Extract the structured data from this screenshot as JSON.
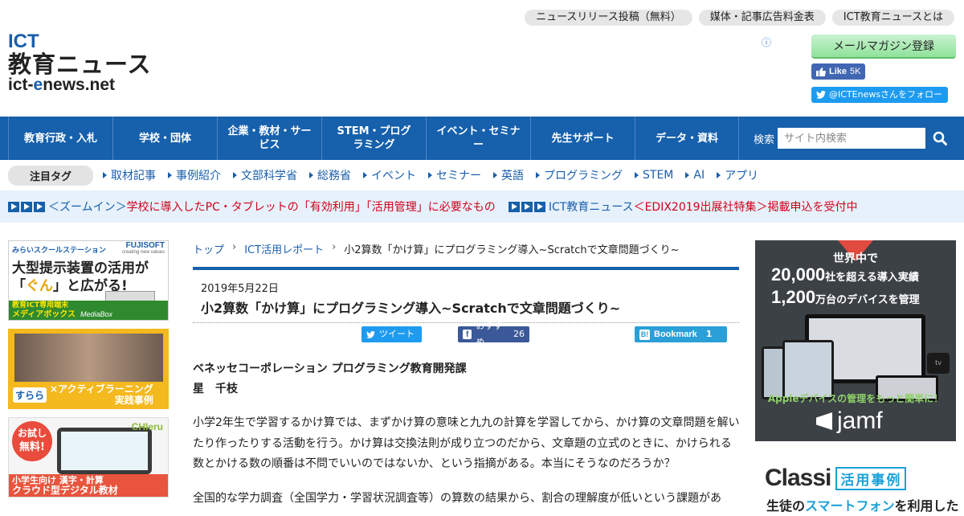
{
  "logo": {
    "line1": "ICT",
    "line2": "教育ニュース",
    "line3a": "ict-",
    "line3b": "e",
    "line3c": "news.net"
  },
  "toplinks": [
    "ニュースリリース投稿（無料）",
    "媒体・記事広告料金表",
    "ICT教育ニュースとは"
  ],
  "mail_button": "メールマガジン登録",
  "fb_like": {
    "label": "Like",
    "count": "5K"
  },
  "twitter_follow": "@ICTEnewsさんをフォロー",
  "nav": {
    "items": [
      "教育行政・入札",
      "学校・団体",
      "企業・教材・サービス",
      "STEM・プログラミング",
      "イベント・セミナー",
      "先生サポート",
      "データ・資料"
    ],
    "search_label": "検索",
    "search_placeholder": "サイト内検索"
  },
  "tags": {
    "title": "注目タグ",
    "items": [
      "取材記事",
      "事例紹介",
      "文部科学省",
      "総務省",
      "イベント",
      "セミナー",
      "英語",
      "プログラミング",
      "STEM",
      "AI",
      "アプリ"
    ]
  },
  "ticker": [
    {
      "blue": "＜ズームイン＞",
      "red": "学校に導入したPC・タブレットの「有効利用」「活用管理」に必要なもの"
    },
    {
      "blue": "ICT教育ニュース",
      "red": "＜EDIX2019出展社特集＞掲載申込を受付中"
    }
  ],
  "banners": {
    "b1": {
      "top": "みらいスクールステーション",
      "brand": "FUJISOFT",
      "brand_sub": "creating new values",
      "headline1": "大型提示装置の活用が",
      "headline2a": "ぐん",
      "headline2b": "と広がる!",
      "foot1": "教育ICT専用端末",
      "foot2": "メディアボックス",
      "foot3": "MediaBox"
    },
    "b2": {
      "logo": "すらら",
      "text1": "×アクティブラーニング",
      "text2": "実践事例"
    },
    "b3": {
      "badge1": "お試し",
      "badge2": "無料!",
      "brand": "CHIeru",
      "foot1": "小学生向け 漢字・計算",
      "foot2": "クラウド型デジタル教材"
    }
  },
  "breadcrumb": [
    "トップ",
    "ICT活用レポート",
    "小2算数「かけ算」にプログラミング導入~Scratchで文章問題づくり~"
  ],
  "article": {
    "date": "2019年5月22日",
    "title": "小2算数「かけ算」にプログラミング導入~Scratchで文章問題づくり~",
    "share_tweet": "ツイート",
    "share_fb": "おすすめ",
    "share_fb_count": "26",
    "share_hb": "Bookmark",
    "share_hb_count": "1",
    "author_org": "ベネッセコーポレーション プログラミング教育開発課",
    "author_name": "星　千枝",
    "para1": "小学2年生で学習するかけ算では、まずかけ算の意味と九九の計算を学習してから、かけ算の文章問題を解いたり作ったりする活動を行う。かけ算は交換法則が成り立つのだから、文章題の立式のときに、かけられる数とかける数の順番は不問でいいのではないか、という指摘がある。本当にそうなのだろうか？",
    "para2": "全国的な学力調査（全国学力・学習状況調査等）の算数の結果から、割合の理解度が低いという課題があ"
  },
  "jamf_ad": {
    "line1": "世界中で",
    "line2a": "20,000",
    "line2b": "社を超える導入実績",
    "line3a": "1,200",
    "line3b": "万台のデバイスを管理",
    "tagline": "Appleデバイスの管理をもっと簡単に！",
    "brand": "jamf",
    "tv": "tv"
  },
  "classi_ad": {
    "brand": "Classi",
    "tag": "活用事例",
    "sub1": "生徒の",
    "sub2": "スマートフォン",
    "sub3": "を利用した"
  },
  "colors": {
    "nav_bg": "#1660ac",
    "accent_blue": "#1a5eab",
    "red": "#d0021b",
    "ticker_bg": "#e6f1fb"
  }
}
